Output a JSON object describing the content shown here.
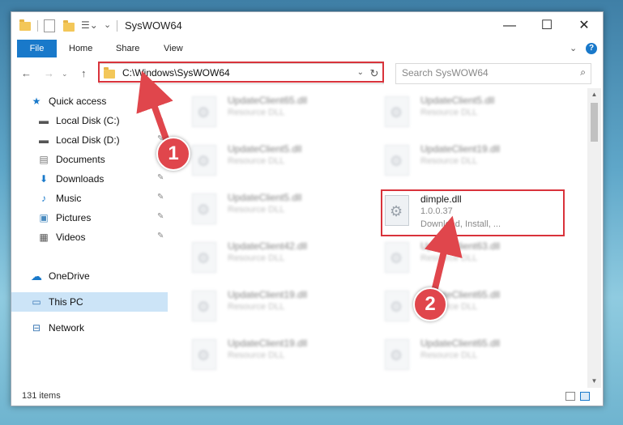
{
  "window": {
    "title": "SysWOW64"
  },
  "caption": {
    "minimize": "—",
    "maximize": "☐",
    "close": "✕"
  },
  "ribbon": {
    "file": "File",
    "home": "Home",
    "share": "Share",
    "view": "View",
    "expand": "⌄",
    "help": "?"
  },
  "nav": {
    "back": "←",
    "forward": "→",
    "up": "↑",
    "recent": "⌄"
  },
  "address": {
    "path": "C:\\Windows\\SysWOW64",
    "dropdown": "⌄",
    "refresh": "↻"
  },
  "search": {
    "placeholder": "Search SysWOW64",
    "icon": "⌕"
  },
  "sidebar": {
    "items": [
      {
        "label": "Quick access",
        "icon": "★",
        "pinned": false
      },
      {
        "label": "Local Disk (C:)",
        "icon": "▬",
        "pinned": true
      },
      {
        "label": "Local Disk (D:)",
        "icon": "▬",
        "pinned": true
      },
      {
        "label": "Documents",
        "icon": "▤",
        "pinned": true
      },
      {
        "label": "Downloads",
        "icon": "⬇",
        "pinned": true
      },
      {
        "label": "Music",
        "icon": "♪",
        "pinned": true
      },
      {
        "label": "Pictures",
        "icon": "▣",
        "pinned": true
      },
      {
        "label": "Videos",
        "icon": "▦",
        "pinned": true
      },
      {
        "label": "OneDrive",
        "icon": "☁",
        "pinned": false
      },
      {
        "label": "This PC",
        "icon": "▭",
        "pinned": false
      },
      {
        "label": "Network",
        "icon": "⊟",
        "pinned": false
      }
    ],
    "pin_icon": "📌"
  },
  "files": {
    "left": [
      {
        "name": "UpdateClient65.dll",
        "type": "Resource DLL"
      },
      {
        "name": "UpdateClient5.dll",
        "type": "Resource DLL"
      },
      {
        "name": "UpdateClient5.dll",
        "type": "Resource DLL"
      },
      {
        "name": "UpdateClient42.dll",
        "type": "Resource DLL"
      },
      {
        "name": "UpdateClient19.dll",
        "type": "Resource DLL"
      },
      {
        "name": "UpdateClient19.dll",
        "type": "Resource DLL"
      }
    ],
    "right": [
      {
        "name": "UpdateClient5.dll",
        "type": "Resource DLL"
      },
      {
        "name": "UpdateClient19.dll",
        "type": "Resource DLL"
      },
      {
        "name": "dimple.dll",
        "version": "1.0.0.37",
        "desc": "Download, Install, ..."
      },
      {
        "name": "UpdateClient63.dll",
        "type": "Resource DLL"
      },
      {
        "name": "UpdateClient65.dll",
        "type": "Resource DLL"
      },
      {
        "name": "UpdateClient65.dll",
        "type": "Resource DLL"
      }
    ]
  },
  "status": {
    "items": "131 items"
  },
  "annotations": {
    "step1": "1",
    "step2": "2"
  },
  "colors": {
    "accent": "#1979ca",
    "highlight": "#d9333b",
    "badge": "#e0464c"
  }
}
